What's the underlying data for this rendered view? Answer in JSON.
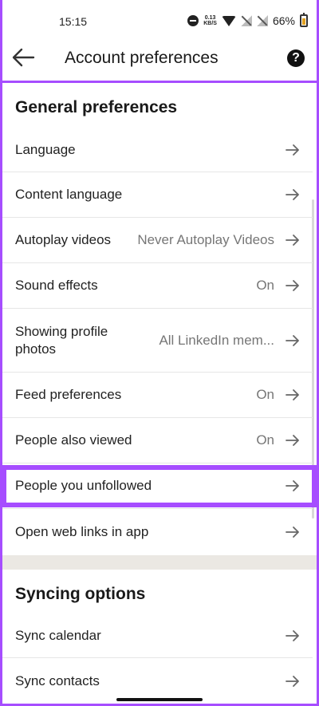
{
  "status_bar": {
    "time": "15:15",
    "net_speed_value": "0.13",
    "net_speed_unit": "KB/S",
    "battery": "66%"
  },
  "app_bar": {
    "title": "Account preferences",
    "back_icon": "arrow-left-icon",
    "help_icon": "help-circle-icon",
    "help_glyph": "?"
  },
  "sections": [
    {
      "title": "General preferences",
      "items": [
        {
          "label": "Language",
          "value": ""
        },
        {
          "label": "Content language",
          "value": ""
        },
        {
          "label": "Autoplay videos",
          "value": "Never Autoplay Videos"
        },
        {
          "label": "Sound effects",
          "value": "On"
        },
        {
          "label": "Showing profile photos",
          "value": "All LinkedIn mem..."
        },
        {
          "label": "Feed preferences",
          "value": "On"
        },
        {
          "label": "People also viewed",
          "value": "On"
        },
        {
          "label": "People you unfollowed",
          "value": ""
        },
        {
          "label": "Open web links in app",
          "value": ""
        }
      ]
    },
    {
      "title": "Syncing options",
      "items": [
        {
          "label": "Sync calendar",
          "value": ""
        },
        {
          "label": "Sync contacts",
          "value": ""
        }
      ]
    }
  ],
  "colors": {
    "highlight": "#a64dff",
    "separator_band": "#ebe8e3"
  }
}
